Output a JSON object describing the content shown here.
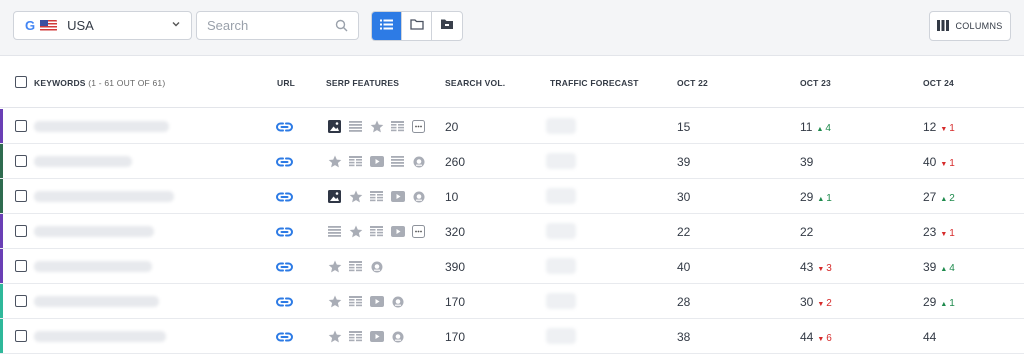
{
  "toolbar": {
    "location": "USA",
    "search_placeholder": "Search",
    "columns_label": "COLUMNS",
    "views": [
      "list-view-icon",
      "folder-icon",
      "tag-folder-icon"
    ]
  },
  "table": {
    "headers": {
      "keywords": "KEYWORDS",
      "keywords_count": "(1 - 61 OUT OF 61)",
      "url": "URL",
      "serp": "SERP FEATURES",
      "volume": "SEARCH VOL.",
      "traffic": "TRAFFIC FORECAST",
      "d1": "OCT 22",
      "d2": "OCT 23",
      "d3": "OCT 24"
    },
    "rows": [
      {
        "stripe": "#6a3fb5",
        "kw_w": 135,
        "serp": [
          "image",
          "list",
          "star",
          "table",
          "more"
        ],
        "volume": "20",
        "d1": "15",
        "d2": "11",
        "d2_t": "4",
        "d2_dir": "up",
        "d3": "12",
        "d3_t": "1",
        "d3_dir": "down"
      },
      {
        "stripe": "#2f6b4f",
        "kw_w": 98,
        "serp": [
          "star",
          "table",
          "video",
          "list",
          "globe"
        ],
        "volume": "260",
        "d1": "39",
        "d2": "39",
        "d2_t": "",
        "d2_dir": "",
        "d3": "40",
        "d3_t": "1",
        "d3_dir": "down"
      },
      {
        "stripe": "#2f6b4f",
        "kw_w": 140,
        "serp": [
          "image",
          "star",
          "table",
          "video",
          "globe"
        ],
        "volume": "10",
        "d1": "30",
        "d2": "29",
        "d2_t": "1",
        "d2_dir": "up",
        "d3": "27",
        "d3_t": "2",
        "d3_dir": "up"
      },
      {
        "stripe": "#6a3fb5",
        "kw_w": 120,
        "serp": [
          "list",
          "star",
          "table",
          "video",
          "more"
        ],
        "volume": "320",
        "d1": "22",
        "d2": "22",
        "d2_t": "",
        "d2_dir": "",
        "d3": "23",
        "d3_t": "1",
        "d3_dir": "down"
      },
      {
        "stripe": "#6a3fb5",
        "kw_w": 118,
        "serp": [
          "star",
          "table",
          "globe"
        ],
        "volume": "390",
        "d1": "40",
        "d2": "43",
        "d2_t": "3",
        "d2_dir": "down",
        "d3": "39",
        "d3_t": "4",
        "d3_dir": "up"
      },
      {
        "stripe": "#2fb89a",
        "kw_w": 125,
        "serp": [
          "star",
          "table",
          "video",
          "globe"
        ],
        "volume": "170",
        "d1": "28",
        "d2": "30",
        "d2_t": "2",
        "d2_dir": "down",
        "d3": "29",
        "d3_t": "1",
        "d3_dir": "up"
      },
      {
        "stripe": "#2fb89a",
        "kw_w": 132,
        "serp": [
          "star",
          "table",
          "video",
          "globe"
        ],
        "volume": "170",
        "d1": "38",
        "d2": "44",
        "d2_t": "6",
        "d2_dir": "down",
        "d3": "44",
        "d3_t": "",
        "d3_dir": ""
      }
    ]
  }
}
